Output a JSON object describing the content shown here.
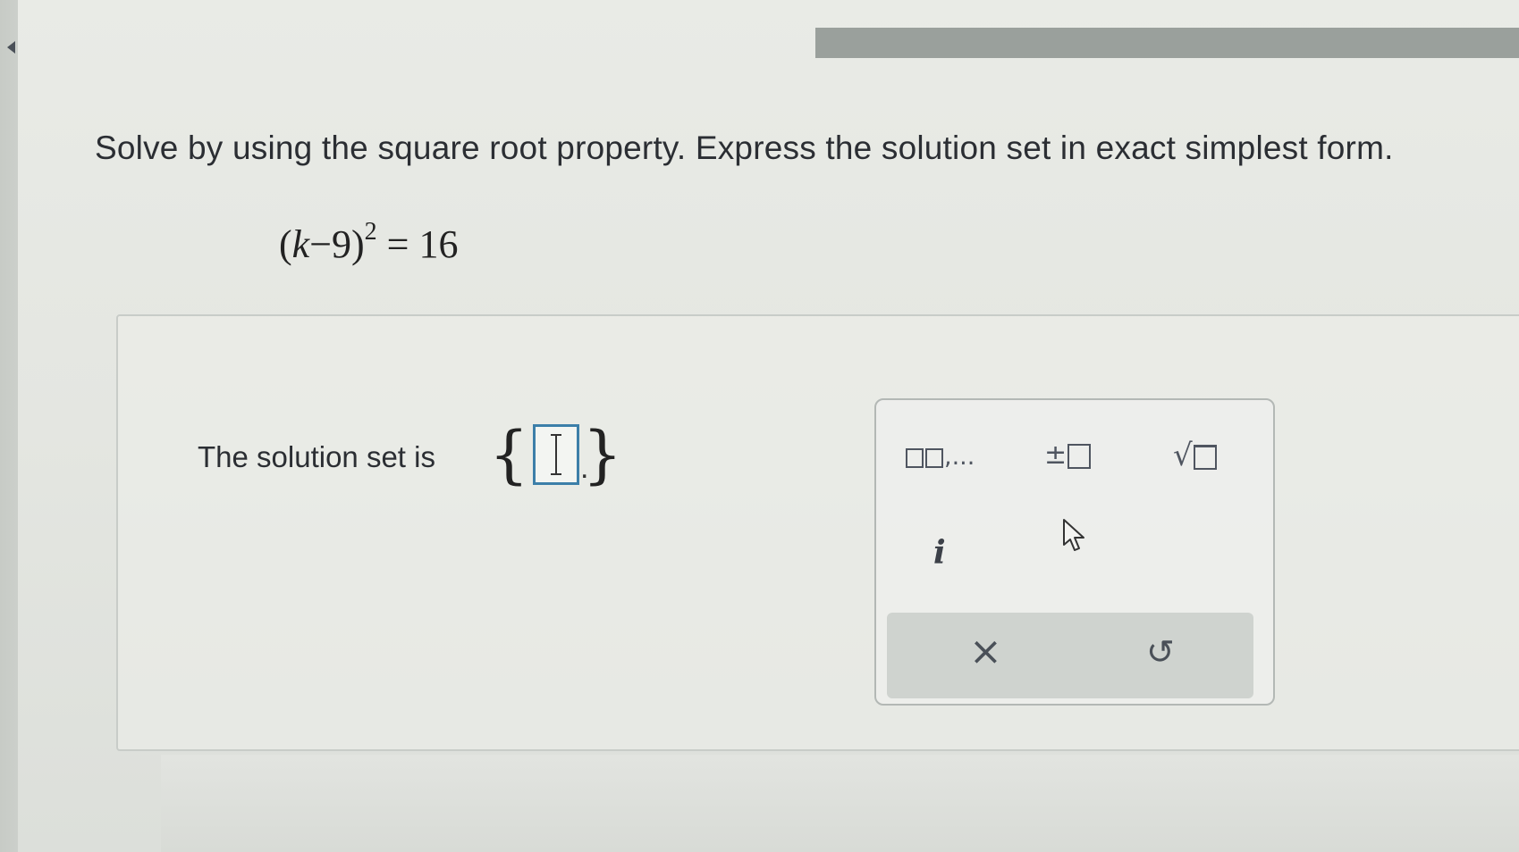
{
  "navigation": {
    "back_icon": "left-triangle-icon"
  },
  "question": {
    "instruction": "Solve by using the square root property. Express the solution set in exact simplest form.",
    "equation": {
      "open": "(",
      "variable": "k",
      "operator": "−9",
      "close": ")",
      "exponent": "2",
      "rhs": "= 16"
    }
  },
  "answer": {
    "label": "The solution set is",
    "open_brace": "{",
    "close_brace": "}",
    "value": "",
    "period": "."
  },
  "keypad": {
    "list_key": ",...",
    "plus_minus_key": "±",
    "sqrt_key": "√",
    "imaginary_key": "i",
    "clear_key": "×",
    "undo_key": "↺"
  },
  "colors": {
    "input_border": "#3c7fa9",
    "text": "#2b2e33"
  }
}
